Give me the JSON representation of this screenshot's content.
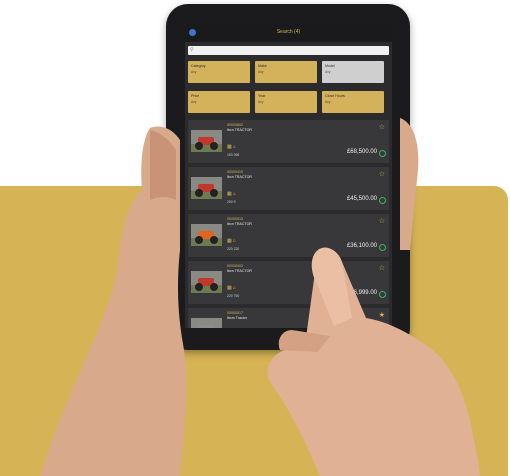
{
  "app": {
    "title": "Search (4)"
  },
  "search": {
    "placeholder": ""
  },
  "filters": [
    {
      "label": "Category",
      "value": "Any",
      "style": "gold"
    },
    {
      "label": "Make",
      "value": "Any",
      "style": "gold"
    },
    {
      "label": "Model",
      "value": "Any",
      "style": "grey"
    },
    {
      "label": "Price",
      "value": "Any",
      "style": "gold"
    },
    {
      "label": "Year",
      "value": "Any",
      "style": "gold"
    },
    {
      "label": "Close Hours",
      "value": "Any",
      "style": "gold"
    }
  ],
  "listings": [
    {
      "lot": "00000802",
      "make": "Ibcn TRACTOR",
      "specs": "193 396",
      "price": "£68,500.00",
      "favorite": false,
      "thumb_color": "#c0392b"
    },
    {
      "lot": "00000419",
      "make": "Ibcn TRACTOR",
      "specs": "200 9",
      "price": "£45,500.00",
      "favorite": false,
      "thumb_color": "#c0392b"
    },
    {
      "lot": "00000515",
      "make": "Ibcn TRACTOR",
      "specs": "220 220",
      "price": "£36,100.00",
      "favorite": false,
      "thumb_color": "#e0651f"
    },
    {
      "lot": "00000403",
      "make": "Ibcn TRACTOR",
      "specs": "220 750",
      "price": "£6,999.00",
      "favorite": false,
      "thumb_color": "#c0392b"
    },
    {
      "lot": "00000517",
      "make": "Ibcm Tractor",
      "specs": "",
      "price": "",
      "favorite": true,
      "thumb_color": "#8c8c8c"
    }
  ],
  "colors": {
    "gold": "#d6b455",
    "dark": "#2b2b2d",
    "accent_green": "#36b36b"
  }
}
